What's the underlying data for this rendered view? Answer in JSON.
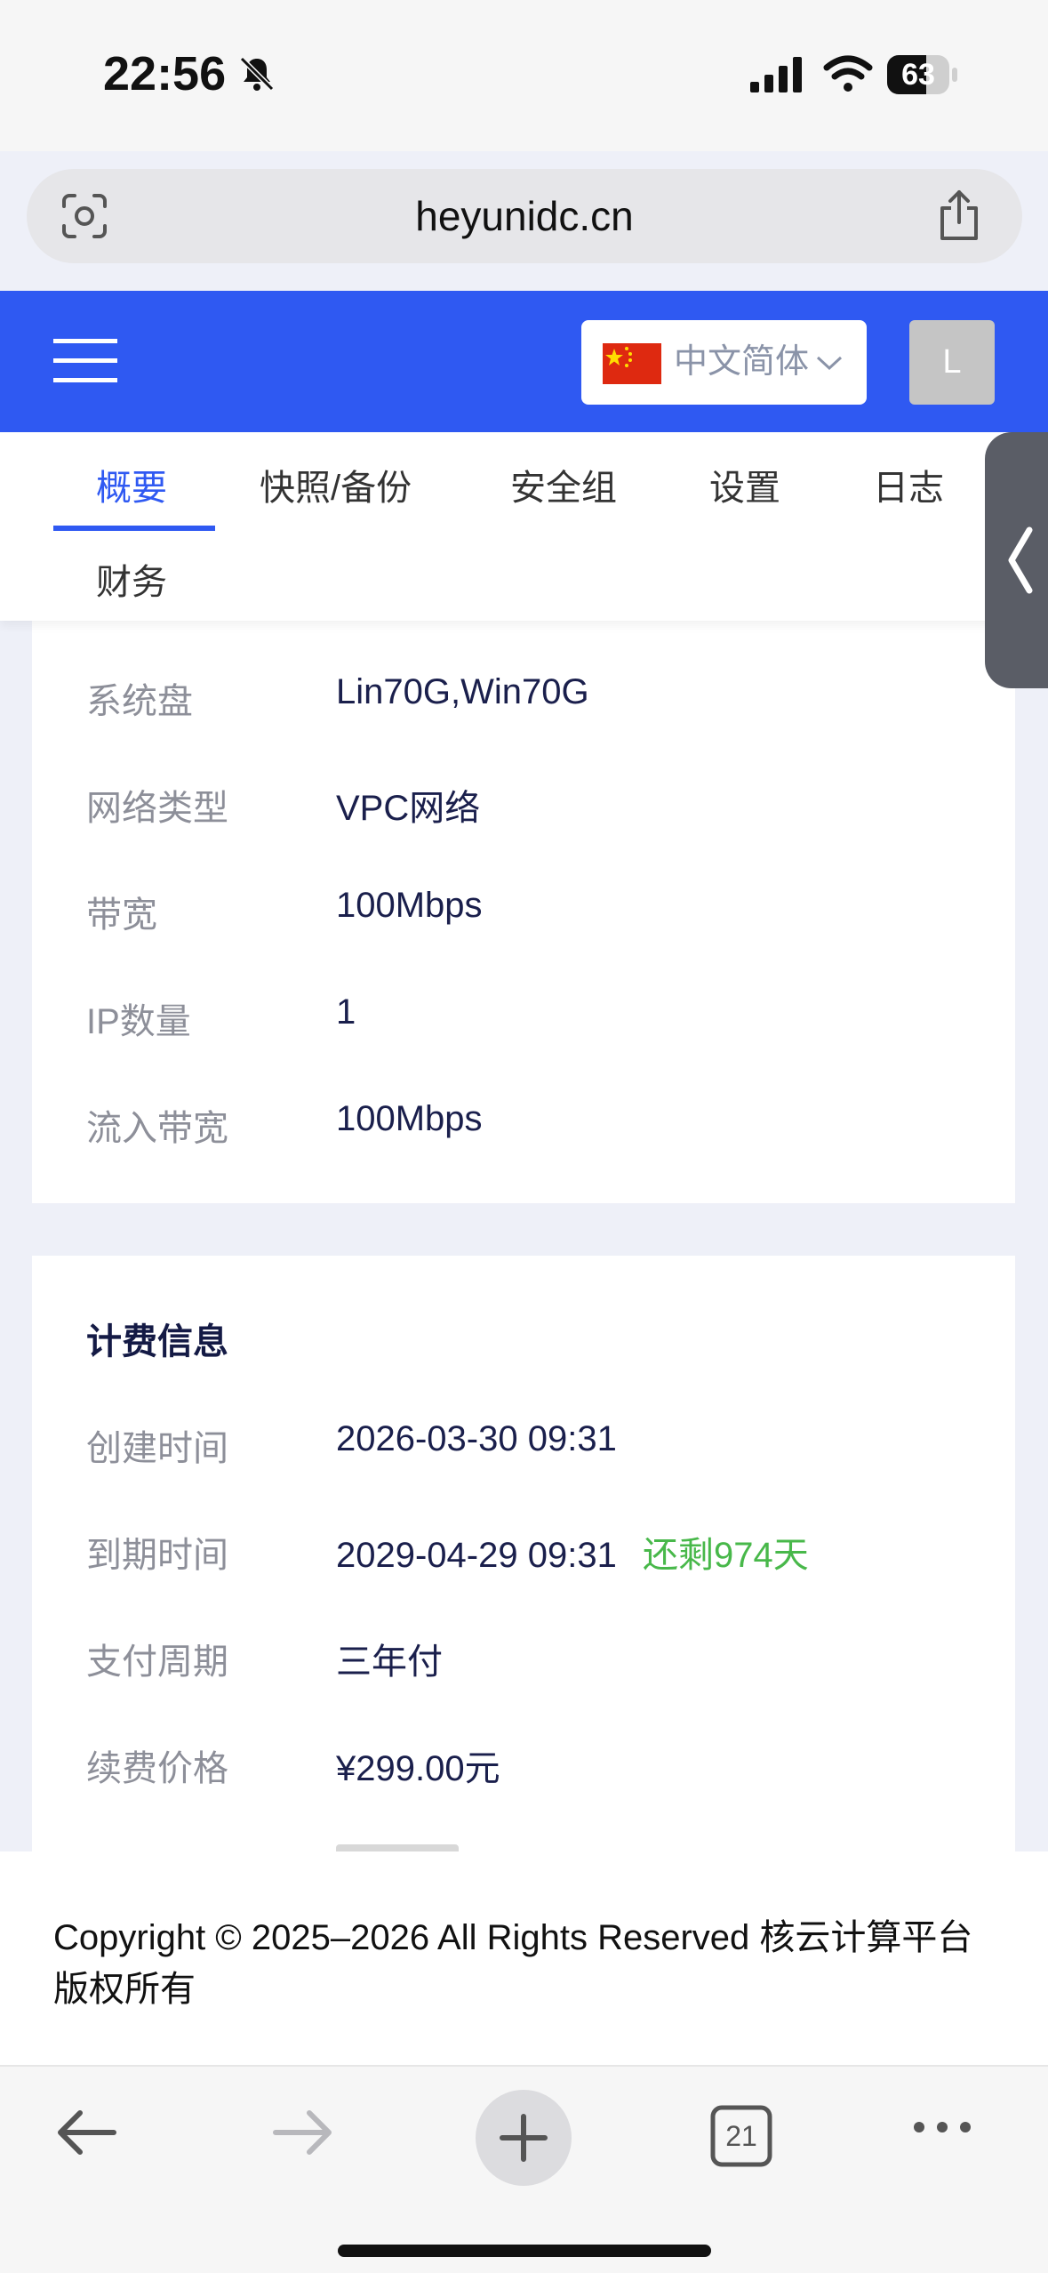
{
  "status_bar": {
    "time": "22:56",
    "battery": "63",
    "battery_level": 0.63
  },
  "browser": {
    "url": "heyunidc.cn",
    "open_tabs": "21"
  },
  "header": {
    "language": "中文简体",
    "avatar_letter": "L"
  },
  "tabs": [
    {
      "label": "概要",
      "active": true
    },
    {
      "label": "快照/备份",
      "active": false
    },
    {
      "label": "安全组",
      "active": false
    },
    {
      "label": "设置",
      "active": false
    },
    {
      "label": "日志",
      "active": false
    },
    {
      "label": "财务",
      "active": false
    }
  ],
  "config_rows": [
    {
      "label": "系统盘",
      "value": "Lin70G,Win70G"
    },
    {
      "label": "网络类型",
      "value": "VPC网络"
    },
    {
      "label": "带宽",
      "value": "100Mbps"
    },
    {
      "label": "IP数量",
      "value": "1"
    },
    {
      "label": "流入带宽",
      "value": "100Mbps"
    }
  ],
  "billing": {
    "title": "计费信息",
    "rows": [
      {
        "label": "创建时间",
        "value": "2026-03-30 09:31"
      },
      {
        "label": "到期时间",
        "value": "2029-04-29 09:31",
        "remaining": "还剩974天"
      },
      {
        "label": "支付周期",
        "value": "三年付"
      },
      {
        "label": "续费价格",
        "value": "¥299.00元"
      }
    ]
  },
  "footer": {
    "copyright": "Copyright © 2025–2026 All Rights Reserved 核云计算平台 版权所有"
  },
  "colors": {
    "primary": "#2f59f2",
    "remaining_green": "#48b84a",
    "value_text": "#1a1f4c",
    "label_text": "#8d8f99"
  }
}
